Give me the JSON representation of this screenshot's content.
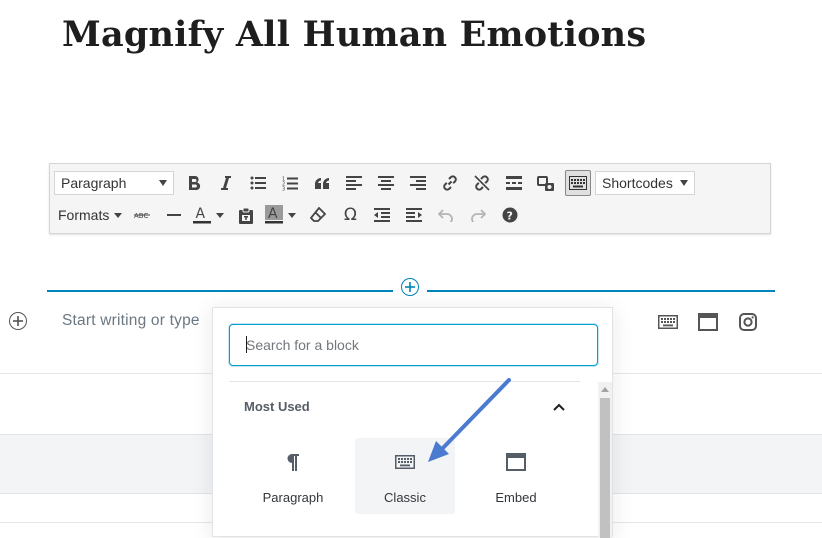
{
  "post": {
    "title": "Magnify All Human Emotions"
  },
  "toolbar": {
    "paragraph_select": "Paragraph",
    "shortcodes_select": "Shortcodes",
    "formats_menu": "Formats",
    "row1_buttons": [
      "bold-icon",
      "italic-icon",
      "bullet-list-icon",
      "numbered-list-icon",
      "blockquote-icon",
      "align-left-icon",
      "align-center-icon",
      "align-right-icon",
      "insert-link-icon",
      "remove-link-icon",
      "read-more-icon",
      "insert-media-icon",
      "toolbar-toggle-icon"
    ],
    "row2_buttons": [
      "strikethrough-icon",
      "horizontal-line-icon",
      "text-color-icon",
      "paste-as-text-icon",
      "background-color-icon",
      "clear-formatting-icon",
      "special-character-icon",
      "outdent-icon",
      "indent-icon",
      "undo-icon",
      "redo-icon",
      "help-icon"
    ]
  },
  "editor": {
    "placeholder": "Start writing or type"
  },
  "inserter": {
    "search_placeholder": "Search for a block",
    "panel_title": "Most Used",
    "blocks": [
      {
        "label": "Paragraph",
        "icon": "paragraph-icon"
      },
      {
        "label": "Classic",
        "icon": "keyboard-icon"
      },
      {
        "label": "Embed",
        "icon": "embed-icon"
      }
    ]
  },
  "colors": {
    "accent": "#0085ba",
    "focus_border": "#00a0d2",
    "annotation_arrow": "#4a7bd0"
  }
}
